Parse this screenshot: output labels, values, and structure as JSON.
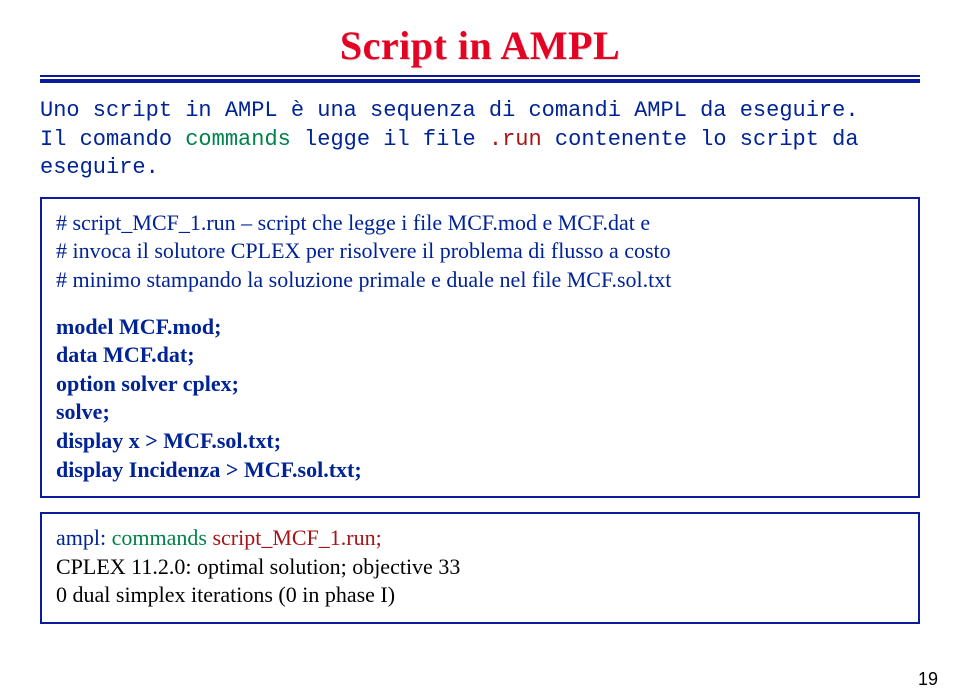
{
  "title": "Script in AMPL",
  "intro": {
    "line1_a": "Uno script in AMPL è una sequenza di comandi AMPL da eseguire.",
    "line2_a": "Il comando ",
    "line2_cmd": "commands",
    "line2_b": " legge il file ",
    "line2_ext": ".run",
    "line2_c": " contenente lo script da eseguire."
  },
  "box1": {
    "l1": "# script_MCF_1.run – script che legge i file MCF.mod e MCF.dat e",
    "l2": "# invoca il solutore CPLEX per risolvere il problema di flusso a costo",
    "l3": "# minimo stampando la soluzione primale e duale nel file MCF.sol.txt",
    "l4": "model MCF.mod;",
    "l5": "data MCF.dat;",
    "l6": "option solver cplex;",
    "l7": "solve;",
    "l8": "display x > MCF.sol.txt;",
    "l9": "display Incidenza > MCF.sol.txt;"
  },
  "box2": {
    "prompt": "ampl: ",
    "cmd": "commands",
    "file": " script_MCF_1.run;",
    "out1": "CPLEX 11.2.0: optimal solution; objective 33",
    "out2": "0 dual simplex iterations (0 in phase I)"
  },
  "pagenum": "19"
}
